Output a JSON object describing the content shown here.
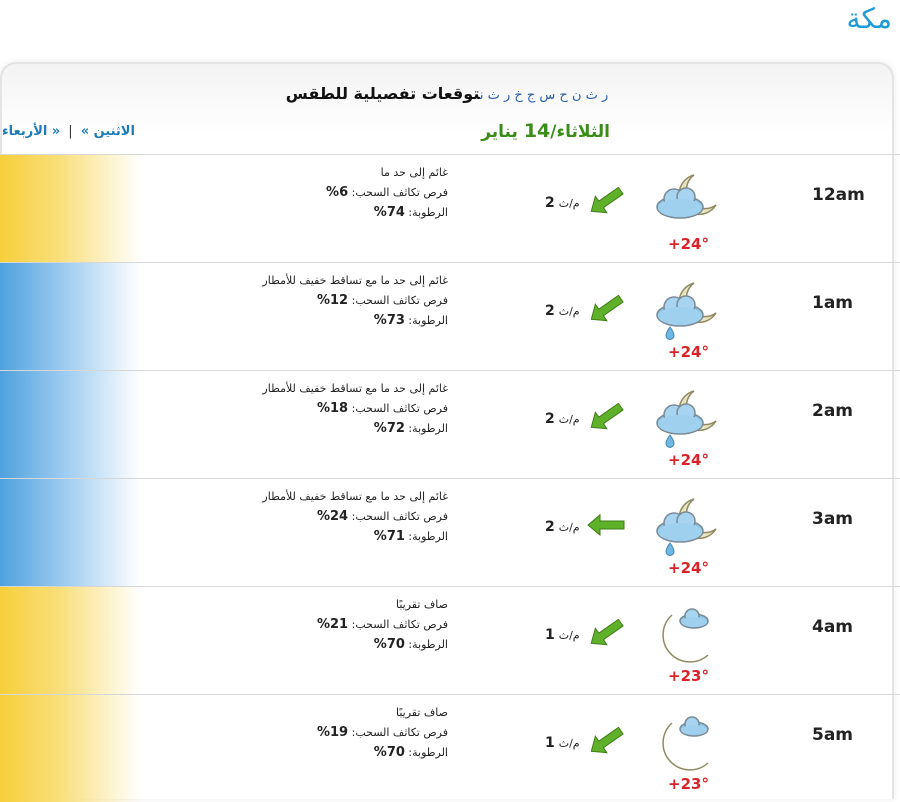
{
  "city": "مكة",
  "panel": {
    "title": "توقعات تفصيلية للطقس",
    "title_letters": "ر ث ن ح س ج خ ر ث ن",
    "date_day": "الثلاثاء/",
    "date_num": "14",
    "date_month": " يناير",
    "nav_prev": "« الأربعاء",
    "nav_sep": "|",
    "nav_next": "الاثنين »"
  },
  "labels": {
    "clouds": "فرص تكاثف السحب:",
    "humidity": "الرطوبة:",
    "wind_unit": "م/ث"
  },
  "rows": [
    {
      "time": "12am",
      "temp": "+24°",
      "wind": "2",
      "condition": "غائم إلى حد ما",
      "clouds": "6%",
      "humidity": "74%",
      "side": "sun",
      "icon": "cloudy-moon-icon",
      "wind_dir": "southwest"
    },
    {
      "time": "1am",
      "temp": "+24°",
      "wind": "2",
      "condition": "غائم إلى حد ما مع تساقط خفيف للأمطار",
      "clouds": "12%",
      "humidity": "73%",
      "side": "rain",
      "icon": "cloudy-moon-rain-icon",
      "wind_dir": "southwest"
    },
    {
      "time": "2am",
      "temp": "+24°",
      "wind": "2",
      "condition": "غائم إلى حد ما مع تساقط خفيف للأمطار",
      "clouds": "18%",
      "humidity": "72%",
      "side": "rain",
      "icon": "cloudy-moon-rain-icon",
      "wind_dir": "southwest"
    },
    {
      "time": "3am",
      "temp": "+24°",
      "wind": "2",
      "condition": "غائم إلى حد ما مع تساقط خفيف للأمطار",
      "clouds": "24%",
      "humidity": "71%",
      "side": "rain",
      "icon": "cloudy-moon-rain-icon",
      "wind_dir": "west"
    },
    {
      "time": "4am",
      "temp": "+23°",
      "wind": "1",
      "condition": "صاف تقريبًا",
      "clouds": "21%",
      "humidity": "70%",
      "side": "sun",
      "icon": "moon-small-cloud-icon",
      "wind_dir": "southwest"
    },
    {
      "time": "5am",
      "temp": "+23°",
      "wind": "1",
      "condition": "صاف تقريبًا",
      "clouds": "19%",
      "humidity": "70%",
      "side": "sun",
      "icon": "moon-small-cloud-icon",
      "wind_dir": "southwest"
    }
  ]
}
